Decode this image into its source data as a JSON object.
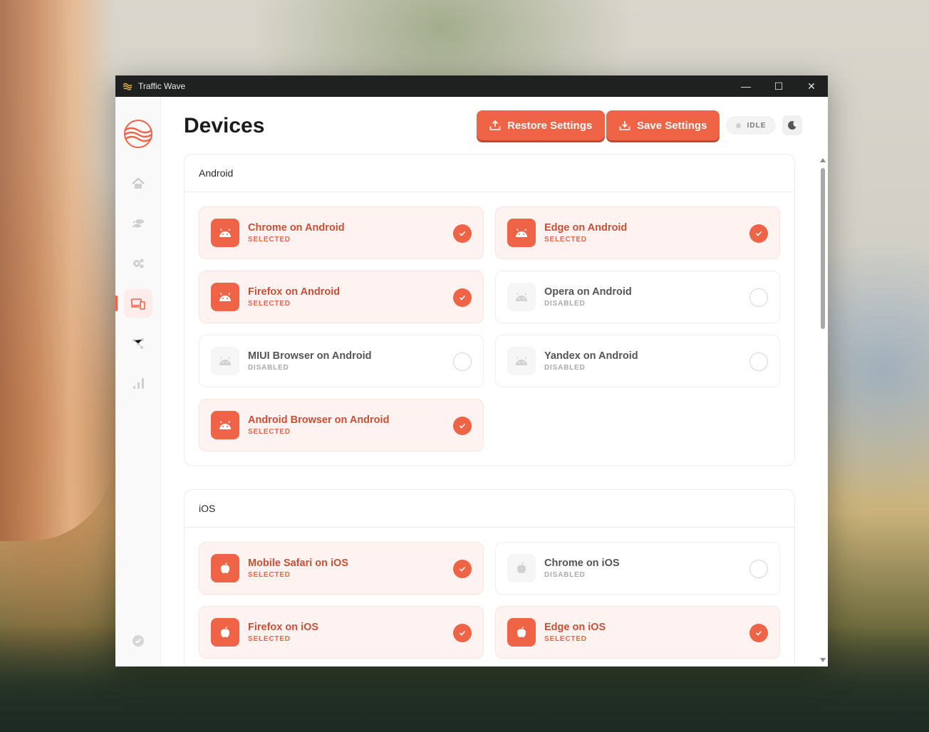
{
  "window": {
    "title": "Traffic Wave",
    "controls": {
      "minimize": "—",
      "maximize": "☐",
      "close": "✕"
    }
  },
  "sidebar": {
    "items": [
      {
        "name": "home",
        "icon": "home-icon"
      },
      {
        "name": "traffic",
        "icon": "traffic-icon"
      },
      {
        "name": "settings",
        "icon": "gears-icon"
      },
      {
        "name": "devices",
        "icon": "devices-icon",
        "active": true
      },
      {
        "name": "network",
        "icon": "network-icon"
      },
      {
        "name": "statistics",
        "icon": "signal-bars-icon"
      }
    ],
    "footer_icon": "verified-badge-icon"
  },
  "header": {
    "page_title": "Devices",
    "restore_label": "Restore Settings",
    "save_label": "Save Settings",
    "status": "IDLE",
    "theme_icon": "moon-icon"
  },
  "colors": {
    "accent": "#ef6347",
    "accent_text": "#c94f35",
    "selected_bg": "#fef3f1"
  },
  "sections": {
    "android": {
      "title": "Android",
      "devices": [
        {
          "name": "Chrome on Android",
          "status": "SELECTED"
        },
        {
          "name": "Edge on Android",
          "status": "SELECTED"
        },
        {
          "name": "Firefox on Android",
          "status": "SELECTED"
        },
        {
          "name": "Opera on Android",
          "status": "DISABLED"
        },
        {
          "name": "MIUI Browser on Android",
          "status": "DISABLED"
        },
        {
          "name": "Yandex on Android",
          "status": "DISABLED"
        },
        {
          "name": "Android Browser on Android",
          "status": "SELECTED"
        }
      ]
    },
    "ios": {
      "title": "iOS",
      "devices": [
        {
          "name": "Mobile Safari on iOS",
          "status": "SELECTED"
        },
        {
          "name": "Chrome on iOS",
          "status": "DISABLED"
        },
        {
          "name": "Firefox on iOS",
          "status": "SELECTED"
        },
        {
          "name": "Edge on iOS",
          "status": "SELECTED"
        }
      ]
    }
  }
}
